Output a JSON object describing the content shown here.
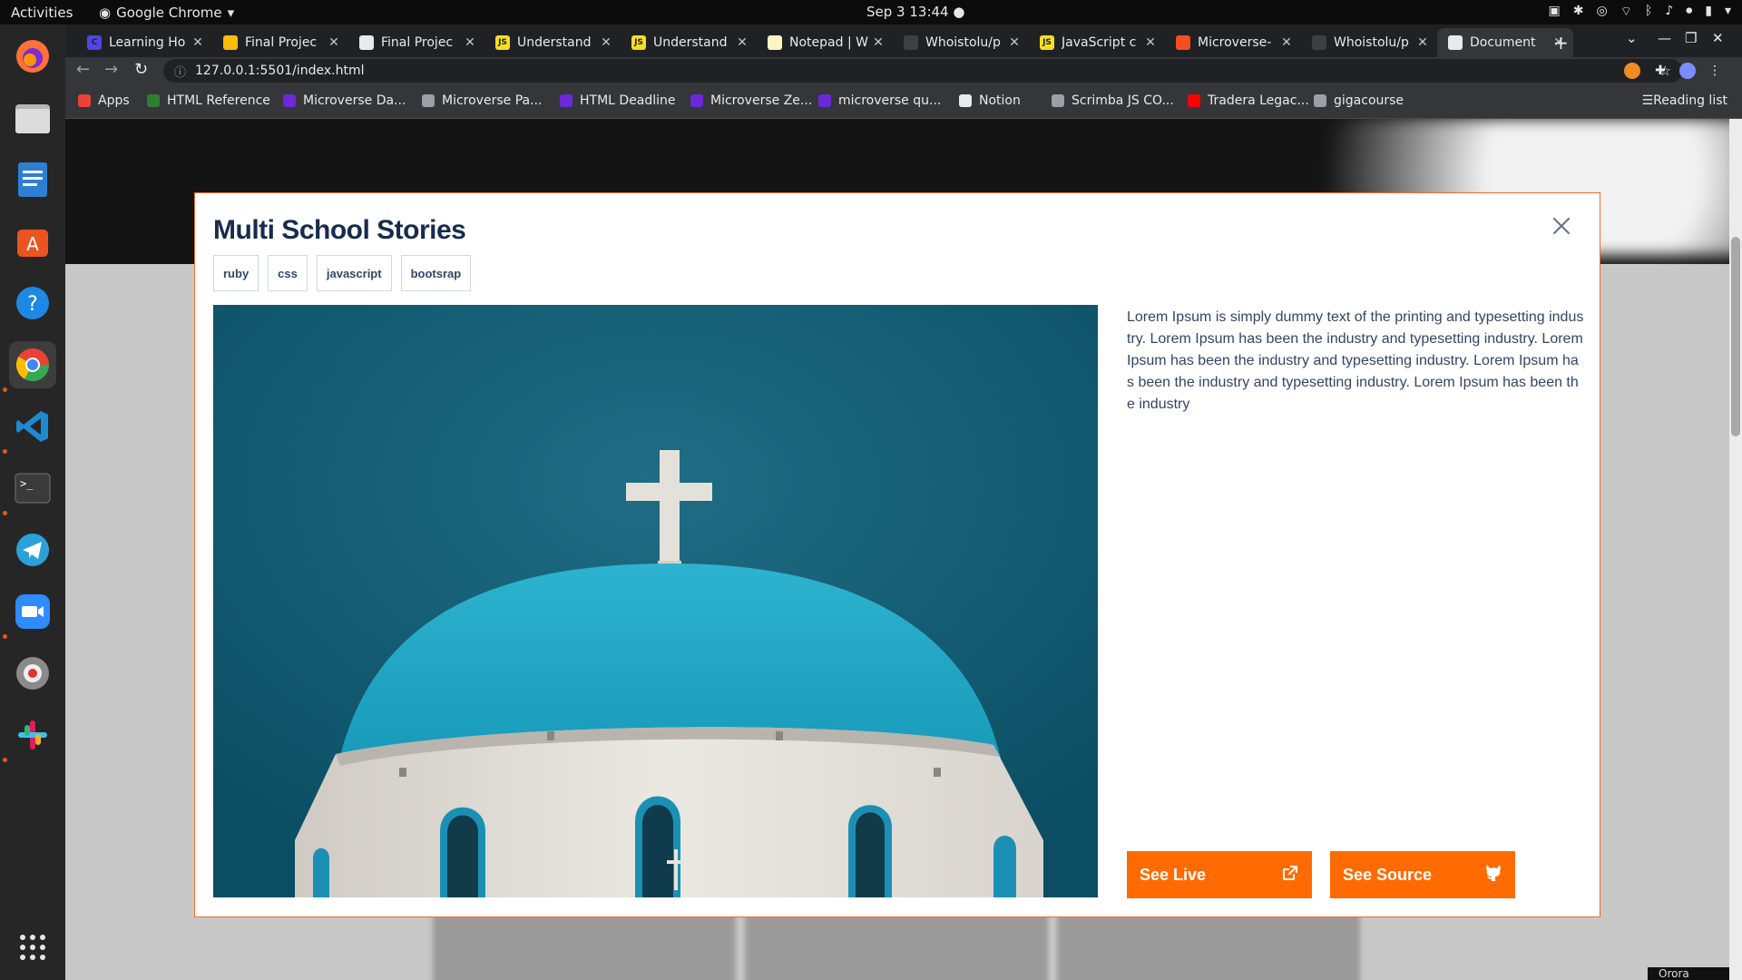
{
  "system": {
    "activities": "Activities",
    "app_name": "Google Chrome",
    "clock": "Sep 3  13:44"
  },
  "dock": {
    "apps": [
      "firefox",
      "files",
      "libreoffice-writer",
      "ubuntu-software",
      "help",
      "google-chrome",
      "vscode",
      "terminal",
      "telegram",
      "zoom",
      "screenshot",
      "slack"
    ],
    "show_apps_icon": "grid-icon"
  },
  "browser": {
    "tabs": [
      {
        "title": "Learning Ho",
        "favicon_color": "#4f46e5",
        "favicon_text": "C"
      },
      {
        "title": "Final Projec",
        "favicon_color": "#fbbc04",
        "favicon_text": ""
      },
      {
        "title": "Final Projec",
        "favicon_color": "#e8eaed",
        "favicon_text": ""
      },
      {
        "title": "Understand",
        "favicon_color": "#f7df1e",
        "favicon_text": "JS"
      },
      {
        "title": "Understand",
        "favicon_color": "#f7df1e",
        "favicon_text": "JS"
      },
      {
        "title": "Notepad | W",
        "favicon_color": "#fff3c4",
        "favicon_text": ""
      },
      {
        "title": "Whoistolu/p",
        "favicon_color": "#3c4043",
        "favicon_text": ""
      },
      {
        "title": "JavaScript c",
        "favicon_color": "#f7df1e",
        "favicon_text": "JS"
      },
      {
        "title": "Microverse-",
        "favicon_color": "#f24e1e",
        "favicon_text": ""
      },
      {
        "title": "Whoistolu/p",
        "favicon_color": "#3c4043",
        "favicon_text": ""
      },
      {
        "title": "Document",
        "favicon_color": "#e8eaed",
        "favicon_text": ""
      }
    ],
    "active_tab_index": 10,
    "url": "127.0.0.1:5501/index.html",
    "bookmarks": [
      {
        "label": "Apps",
        "color": "#ea4335"
      },
      {
        "label": "HTML Reference",
        "color": "#2e7d32"
      },
      {
        "label": "Microverse Da...",
        "color": "#6d28d9"
      },
      {
        "label": "Microverse Pa...",
        "color": "#9aa0a6"
      },
      {
        "label": "HTML Deadline",
        "color": "#6d28d9"
      },
      {
        "label": "Microverse Ze...",
        "color": "#6d28d9"
      },
      {
        "label": "microverse qu...",
        "color": "#6d28d9"
      },
      {
        "label": "Notion",
        "color": "#e8eaed"
      },
      {
        "label": "Scrimba JS CO...",
        "color": "#9aa0a6"
      },
      {
        "label": "Tradera Legac...",
        "color": "#ff0000"
      },
      {
        "label": "gigacourse",
        "color": "#9aa0a6"
      }
    ],
    "reading_list": "Reading list"
  },
  "modal": {
    "title": "Multi School Stories",
    "tags": [
      "ruby",
      "css",
      "javascript",
      "bootsrap"
    ],
    "image_alt": "church-dome-photo",
    "description": "Lorem Ipsum is simply dummy text of the printing and typesetting industry. Lorem Ipsum has been the industry and typesetting industry. Lorem Ipsum has been the industry and typesetting industry. Lorem Ipsum has been the industry and typesetting industry. Lorem Ipsum has been the industry",
    "see_live": "See Live",
    "see_source": "See Source",
    "accent_color": "#ff6b00",
    "title_color": "#172b4d",
    "text_color": "#344563"
  },
  "page": {
    "corner_text": "Orora"
  }
}
